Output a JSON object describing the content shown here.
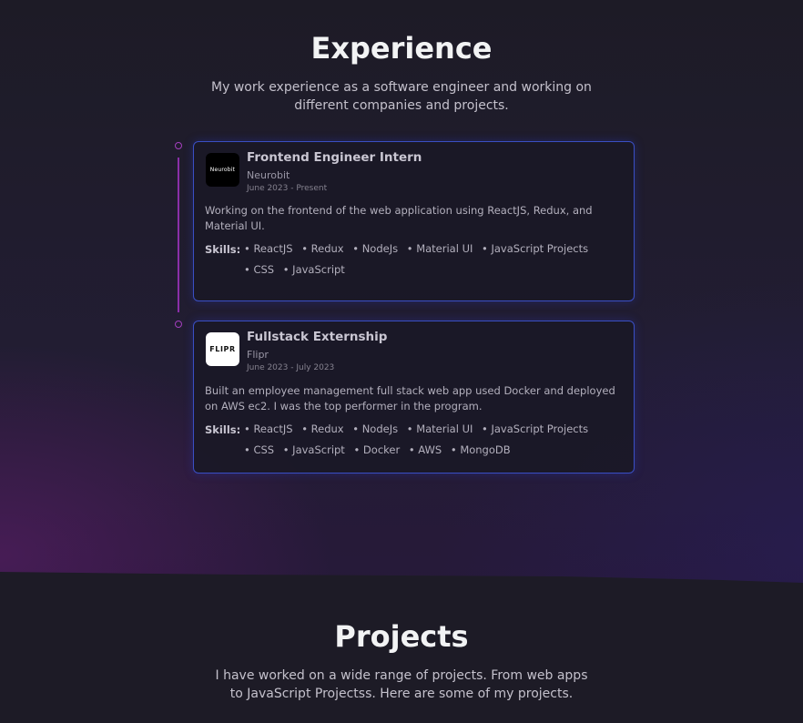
{
  "experience": {
    "title": "Experience",
    "description": "My work experience as a software engineer and working on different companies and projects.",
    "items": [
      {
        "role": "Frontend Engineer Intern",
        "company": "Neurobit",
        "logo_text": "Neurobit",
        "date": "June 2023 - Present",
        "description": "Working on the frontend of the web application using ReactJS, Redux, and Material UI.",
        "skills_label": "Skills:",
        "skills": [
          "• ReactJS",
          "• Redux",
          "• NodeJs",
          "• Material UI",
          "• JavaScript Projects",
          "• CSS",
          "• JavaScript"
        ]
      },
      {
        "role": "Fullstack Externship",
        "company": "Flipr",
        "logo_text": "FLIPR",
        "date": "June 2023 - July 2023",
        "description": "Built an employee management full stack web app used Docker and deployed on AWS ec2. I was the top performer in the program.",
        "skills_label": "Skills:",
        "skills": [
          "• ReactJS",
          "• Redux",
          "• NodeJs",
          "• Material UI",
          "• JavaScript Projects",
          "• CSS",
          "• JavaScript",
          "• Docker",
          "• AWS",
          "• MongoDB"
        ]
      }
    ]
  },
  "projects": {
    "title": "Projects",
    "description": "I have worked on a wide range of projects. From web apps to JavaScript Projectss. Here are some of my projects."
  }
}
